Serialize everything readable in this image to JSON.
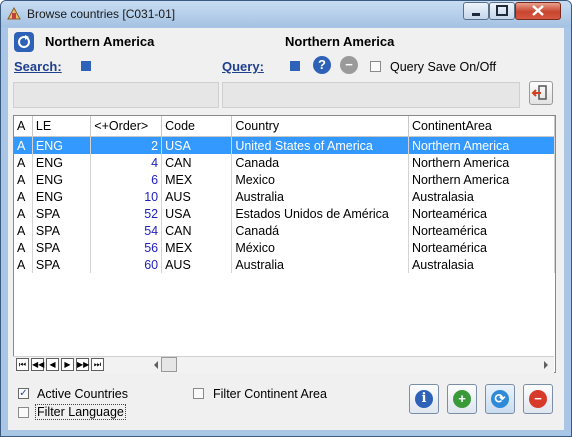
{
  "window": {
    "title": "Browse countries [C031-01]"
  },
  "header": {
    "left_title": "Northern America",
    "right_title": "Northern America"
  },
  "search": {
    "label": "Search:"
  },
  "query": {
    "label": "Query:",
    "save_label": "Query Save On/Off"
  },
  "grid": {
    "columns": [
      "A",
      "LE",
      "<+Order>",
      "Code",
      "Country",
      "ContinentArea"
    ],
    "rows": [
      [
        "A",
        "ENG",
        "2",
        "USA",
        "United States of America",
        "Northern America"
      ],
      [
        "A",
        "ENG",
        "4",
        "CAN",
        "Canada",
        "Northern America"
      ],
      [
        "A",
        "ENG",
        "6",
        "MEX",
        "Mexico",
        "Northern America"
      ],
      [
        "A",
        "ENG",
        "10",
        "AUS",
        "Australia",
        "Australasia"
      ],
      [
        "A",
        "SPA",
        "52",
        "USA",
        "Estados Unidos de América",
        "Norteamérica"
      ],
      [
        "A",
        "SPA",
        "54",
        "CAN",
        "Canadá",
        "Norteamérica"
      ],
      [
        "A",
        "SPA",
        "56",
        "MEX",
        "México",
        "Norteamérica"
      ],
      [
        "A",
        "SPA",
        "60",
        "AUS",
        "Australia",
        "Australasia"
      ]
    ],
    "selected_row": 0
  },
  "filters": {
    "active_countries": "Active Countries",
    "filter_language": "Filter Language",
    "filter_continent_area": "Filter Continent Area"
  },
  "colors": {
    "selection": "#3399ff",
    "accent_blue": "#2e62b8"
  }
}
